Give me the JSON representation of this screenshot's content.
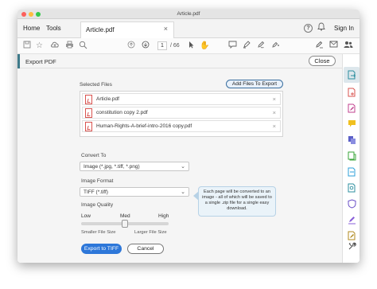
{
  "window": {
    "title": "Article.pdf"
  },
  "tabs": {
    "home": "Home",
    "tools": "Tools",
    "document": "Article.pdf",
    "sign_in": "Sign In"
  },
  "toolbar": {
    "page_current": "1",
    "page_total": "/ 66"
  },
  "panel": {
    "title": "Export PDF",
    "close_label": "Close"
  },
  "export": {
    "selected_files_label": "Selected Files",
    "add_files_label": "Add Files To Export",
    "files": [
      "Article.pdf",
      "constitution copy 2.pdf",
      "Human-Rights-A-brief-intro-2016 copy.pdf"
    ],
    "convert_to_label": "Convert To",
    "convert_to_value": "Image (*.jpg, *.tiff, *.png)",
    "image_format_label": "Image Format",
    "image_format_value": "TIFF (*.tiff)",
    "image_quality_label": "Image Quality",
    "quality_low": "Low",
    "quality_med": "Med",
    "quality_high": "High",
    "quality_level": 0.5,
    "smaller_size": "Smaller File Size",
    "larger_size": "Larger File Size",
    "tooltip": "Each page will be converted to an image - all of which will be saved to a single .zip file for a single easy download.",
    "primary_button": "Export to TIFF",
    "cancel_button": "Cancel"
  },
  "colors": {
    "accent": "#2d77d9",
    "panel_accent": "#3e7a8a",
    "pdf_red": "#d9534f"
  }
}
